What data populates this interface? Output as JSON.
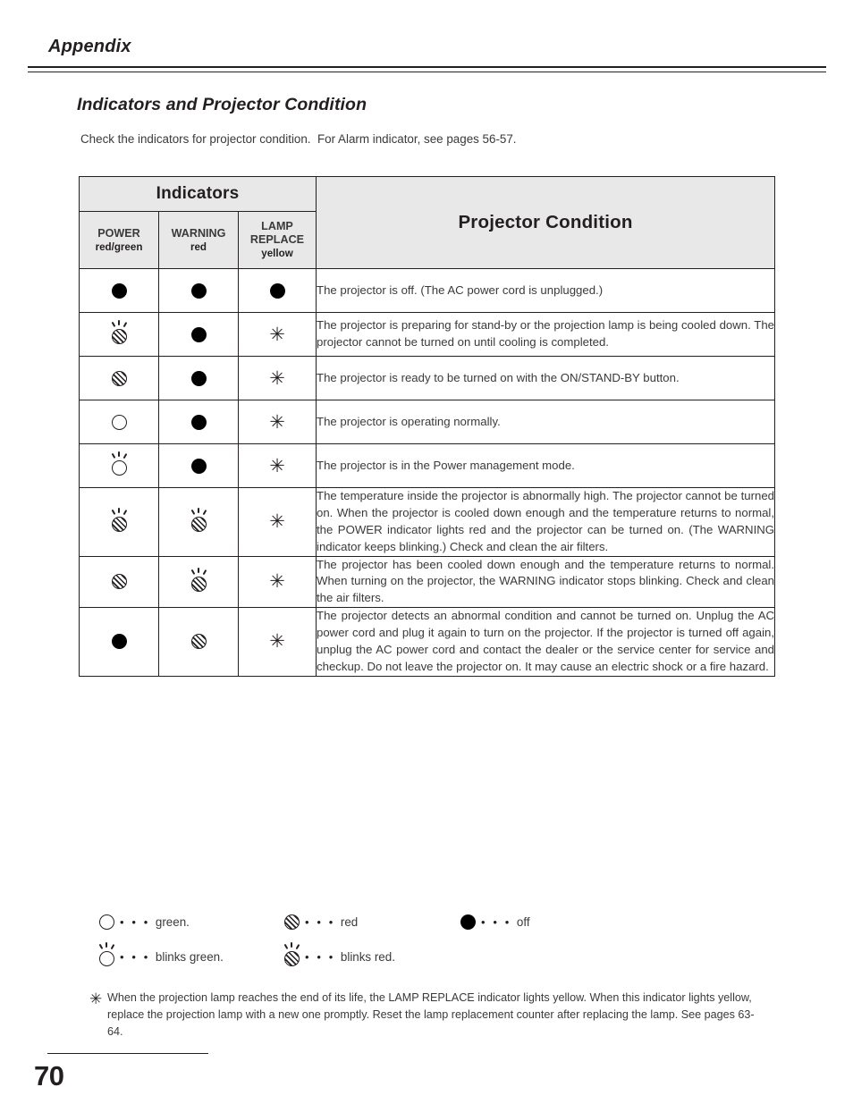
{
  "page": {
    "running_head": "Appendix",
    "page_number": "70"
  },
  "section": {
    "title": "Indicators and Projector Condition",
    "intro": "Check the indicators for projector condition.  For Alarm indicator, see pages 56-57."
  },
  "table": {
    "group_header": "Indicators",
    "condition_header": "Projector Condition",
    "columns": [
      {
        "name": "POWER",
        "colors": "red/green"
      },
      {
        "name": "WARNING",
        "colors": "red"
      },
      {
        "name": "LAMP REPLACE",
        "name_line1": "LAMP",
        "name_line2": "REPLACE",
        "colors": "yellow"
      }
    ],
    "rows": [
      {
        "power": "off",
        "warning": "off",
        "lamp": "off",
        "condition": "The projector is off. (The AC power cord is unplugged.)"
      },
      {
        "power": "blinks-red",
        "warning": "off",
        "lamp": "asterisk",
        "condition": "The projector is preparing for stand-by or the projection lamp is being cooled down. The projector cannot be turned on until cooling is completed."
      },
      {
        "power": "red",
        "warning": "off",
        "lamp": "asterisk",
        "condition": "The projector is ready to be turned on with the ON/STAND-BY button."
      },
      {
        "power": "green",
        "warning": "off",
        "lamp": "asterisk",
        "condition": "The projector is operating normally."
      },
      {
        "power": "blinks-green",
        "warning": "off",
        "lamp": "asterisk",
        "condition": "The projector is in the Power management mode."
      },
      {
        "power": "blinks-red",
        "warning": "blinks-red",
        "lamp": "asterisk",
        "condition": "The temperature inside the projector is abnormally high. The projector cannot be turned on. When the projector is cooled down enough and the temperature returns to normal, the POWER indicator lights red and the projector can be turned on. (The WARNING indicator keeps blinking.) Check and clean the air filters."
      },
      {
        "power": "red",
        "warning": "blinks-red",
        "lamp": "asterisk",
        "condition": "The projector has been cooled down enough and the temperature returns to normal. When turning on the projector, the WARNING indicator stops blinking. Check and clean the air filters."
      },
      {
        "power": "off",
        "warning": "red",
        "lamp": "asterisk",
        "condition": "The projector detects an abnormal condition and cannot be turned on. Unplug the AC power cord and plug it again to turn on the projector. If the projector is turned off again, unplug the AC power cord and contact the dealer or the service center for service and checkup. Do not leave the projector on. It may cause an electric shock or a fire hazard."
      }
    ]
  },
  "legend": {
    "dots": "• • •",
    "items": [
      {
        "symbol": "green",
        "label": "green."
      },
      {
        "symbol": "red",
        "label": "red"
      },
      {
        "symbol": "off",
        "label": "off"
      },
      {
        "symbol": "blinks-green",
        "label": "blinks green."
      },
      {
        "symbol": "blinks-red",
        "label": "blinks red."
      }
    ]
  },
  "footnote": {
    "marker": "✳",
    "text": "When the projection lamp reaches the end of its life, the LAMP REPLACE indicator lights yellow. When this indicator lights yellow, replace the projection lamp with a new one promptly. Reset the lamp replacement counter after replacing the lamp. See pages 63-64."
  },
  "symbols": {
    "asterisk": "✳"
  }
}
